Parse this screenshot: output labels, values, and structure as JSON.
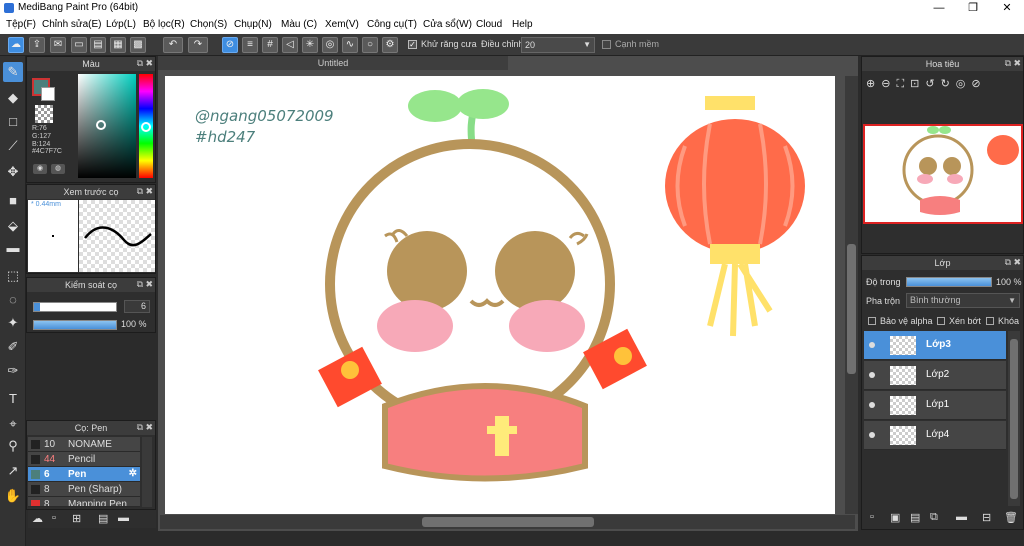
{
  "app": {
    "title": "MediBang Paint Pro (64bit)"
  },
  "window": {
    "minimize": "—",
    "maximize": "❐",
    "close": "✕"
  },
  "menu": [
    "Tệp(F)",
    "Chỉnh sửa(E)",
    "Lớp(L)",
    "Bộ lọc(R)",
    "Chọn(S)",
    "Chụp(N)",
    "Màu (C)",
    "Xem(V)",
    "Công cụ(T)",
    "Cửa sổ(W)",
    "Cloud",
    "Help"
  ],
  "toolbar": {
    "antialias": "Khử răng cưa",
    "adjust": "Điều chỉnh",
    "adjust_value": "20",
    "smooth": "Cạnh mềm"
  },
  "color_panel": {
    "title": "Màu",
    "rgb": "R:76\nG:127\nB:124",
    "hex": "#4C7F7C",
    "fg": "#4C7F7C"
  },
  "preview_panel": {
    "title": "Xem trước cọ",
    "size": "0.44mm"
  },
  "brush_control": {
    "title": "Kiểm soát cọ",
    "size": "6",
    "opacity": "100 %"
  },
  "brush_panel": {
    "title": "Cọ: Pen",
    "items": [
      {
        "num": "10",
        "name": "NONAME",
        "color": "#222222"
      },
      {
        "num": "44",
        "name": "Pencil",
        "color": "#222222"
      },
      {
        "num": "6",
        "name": "Pen",
        "color": "#4C7F7C"
      },
      {
        "num": "8",
        "name": "Pen (Sharp)",
        "color": "#222222"
      },
      {
        "num": "8",
        "name": "Mapping Pen",
        "color": "#e03030"
      }
    ]
  },
  "doc": {
    "tab": "Untitled",
    "watermark_line1": "@ngang05072009",
    "watermark_line2": "#hd247"
  },
  "navigator": {
    "title": "Hoa tiêu"
  },
  "layers": {
    "title": "Lớp",
    "opacity_label": "Độ trong",
    "opacity_value": "100 %",
    "blend_label": "Pha trộn",
    "blend_value": "Bình thường",
    "protect_alpha": "Bảo vệ alpha",
    "clip": "Xén bớt",
    "lock": "Khóa",
    "items": [
      {
        "name": "Lớp3",
        "selected": true
      },
      {
        "name": "Lớp2",
        "selected": false
      },
      {
        "name": "Lớp1",
        "selected": false
      },
      {
        "name": "Lớp4",
        "selected": false
      }
    ]
  }
}
